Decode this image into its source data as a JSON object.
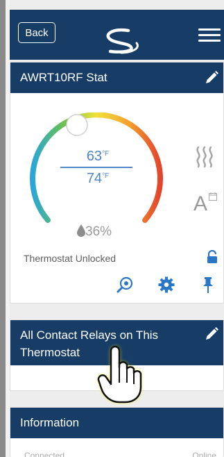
{
  "topbar": {
    "back_label": "Back",
    "brand_color": "#173c66"
  },
  "thermostat_card": {
    "title": "AWRT10RF Stat",
    "set_point": "63",
    "current_temp": "74",
    "degree_unit": "°F",
    "humidity": "36%",
    "lock_status": "Thermostat Unlocked",
    "mode_icon": "heat-icon",
    "schedule_icon": "auto-schedule-icon",
    "auto_letter": "A"
  },
  "relays_card": {
    "title": "All Contact Relays on This Thermostat"
  },
  "info_card": {
    "title": "Information",
    "row_label": "Connected",
    "row_value": "Online"
  },
  "accent_color": "#2a77c9"
}
